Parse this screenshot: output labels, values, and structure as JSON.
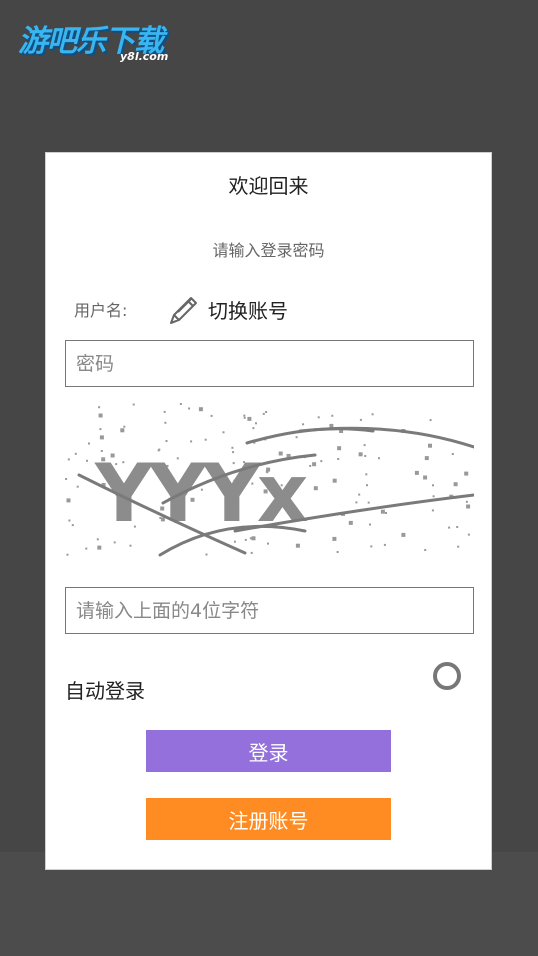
{
  "watermark": {
    "brand": "游吧乐下载",
    "domain": "y8l.com"
  },
  "login_card": {
    "title": "欢迎回来",
    "subtitle": "请输入登录密码",
    "username_label": "用户名:",
    "switch_account": "切换账号",
    "password_placeholder": "密码",
    "captcha_text": "YYYx",
    "captcha_placeholder": "请输入上面的4位字符",
    "auto_login_label": "自动登录",
    "login_button": "登录",
    "register_button": "注册账号"
  },
  "colors": {
    "background": "#464646",
    "login_button": "#9370db",
    "register_button": "#ff8c22",
    "watermark": "#39b5f0"
  }
}
